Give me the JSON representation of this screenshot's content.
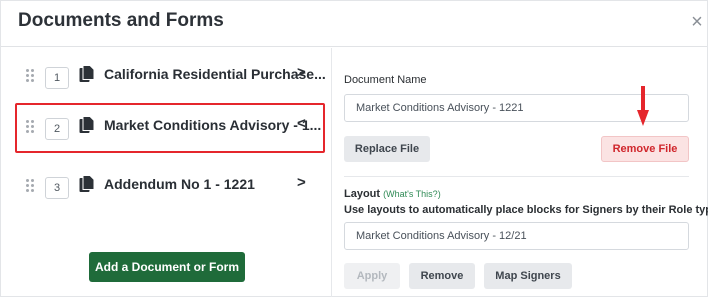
{
  "dialog": {
    "title": "Documents and Forms",
    "close_glyph": "×"
  },
  "documents": [
    {
      "number": "1",
      "name": "California Residential Purchase...",
      "chevron": ">",
      "active": false
    },
    {
      "number": "2",
      "name": "Market Conditions Advisory - 1...",
      "chevron": "<",
      "active": true
    },
    {
      "number": "3",
      "name": "Addendum No 1 - 1221",
      "chevron": ">",
      "active": false
    }
  ],
  "add_button_label": "Add a Document or Form",
  "details": {
    "document_name_label": "Document Name",
    "document_name_value": "Market Conditions Advisory - 1221",
    "replace_label": "Replace File",
    "remove_file_label": "Remove File",
    "layout_label": "Layout",
    "layout_help": "(What's This?)",
    "layout_description": "Use layouts to automatically place blocks for Signers by their Role type.",
    "layout_value": "Market Conditions Advisory - 12/21",
    "apply_label": "Apply",
    "remove_label": "Remove",
    "map_signers_label": "Map Signers"
  },
  "icons": {
    "drag": "drag-handle-icon",
    "file": "file-copy-icon",
    "close": "close-icon",
    "annotation": "red-arrow-down-icon"
  },
  "colors": {
    "primary": "#1f6b3a",
    "danger_text": "#d0262c",
    "danger_bg": "#fbe3e3",
    "highlight": "#e5262c"
  }
}
